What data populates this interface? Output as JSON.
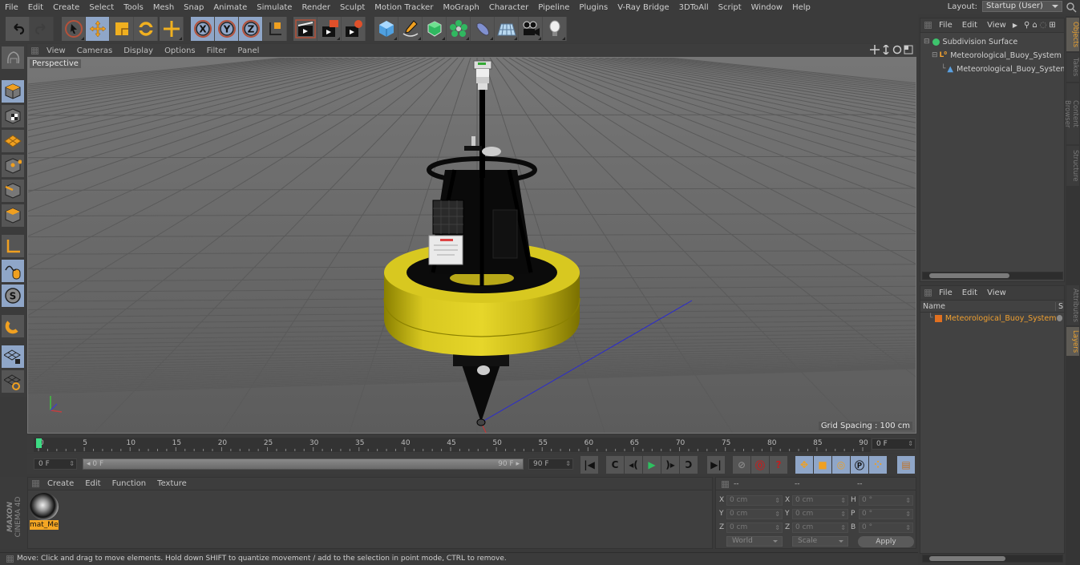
{
  "menubar": {
    "items": [
      "File",
      "Edit",
      "Create",
      "Select",
      "Tools",
      "Mesh",
      "Snap",
      "Animate",
      "Simulate",
      "Render",
      "Sculpt",
      "Motion Tracker",
      "MoGraph",
      "Character",
      "Pipeline",
      "Plugins",
      "V-Ray Bridge",
      "3DToAll",
      "Script",
      "Window",
      "Help"
    ],
    "layout_label": "Layout:",
    "layout_value": "Startup (User)"
  },
  "toolbar": {
    "groups": [
      [
        "undo-icon",
        "redo-icon"
      ],
      [
        "live-selection-icon",
        "move-icon",
        "scale-icon",
        "rotate-icon"
      ],
      [
        "create-object-icon"
      ],
      [
        "x-axis-lock-icon",
        "y-axis-lock-icon",
        "z-axis-lock-icon",
        "world-coordinates-icon"
      ],
      [
        "render-view-icon",
        "render-to-picture-viewer-icon",
        "render-settings-icon"
      ],
      [
        "cube-primitive-icon",
        "pen-spline-icon",
        "subdivision-surface-icon",
        "cloner-icon",
        "deformer-icon",
        "floor-icon",
        "camera-icon",
        "light-icon"
      ]
    ]
  },
  "left_tools": [
    "make-editable-icon",
    "model-mode-icon",
    "texture-mode-icon",
    "workplane-mode-icon",
    "points-mode-icon",
    "edges-mode-icon",
    "polygons-mode-icon",
    "axis-mode-icon",
    "tweak-mode-icon",
    "solo-mode-icon",
    "snap-icon",
    "locked-workplane-icon",
    "planar-workplane-icon"
  ],
  "viewport": {
    "menu": [
      "View",
      "Cameras",
      "Display",
      "Options",
      "Filter",
      "Panel"
    ],
    "camera_label": "Perspective",
    "grid_spacing": "Grid Spacing : 100 cm",
    "nav_icons": [
      "pan-icon",
      "dolly-icon",
      "orbit-icon",
      "maximize-view-icon"
    ]
  },
  "timeline": {
    "ticks": [
      "0",
      "5",
      "10",
      "15",
      "20",
      "25",
      "30",
      "35",
      "40",
      "45",
      "50",
      "55",
      "60",
      "65",
      "70",
      "75",
      "80",
      "85",
      "90"
    ],
    "current_frame": "0 F",
    "start_frame": "0 F",
    "range_start": "0 F",
    "range_end": "90 F",
    "end_frame": "90 F",
    "playhead_fraction": 0
  },
  "transport": {
    "buttons": [
      "go-to-start-icon",
      "previous-key-icon",
      "previous-frame-icon",
      "play-forward-icon",
      "next-frame-icon",
      "next-key-icon",
      "go-to-end-icon",
      "motion-record-icon",
      "record-active-objects-icon",
      "autokeying-icon",
      "key-position-icon",
      "key-scale-icon",
      "key-rotation-icon",
      "key-parameter-icon",
      "key-pla-icon",
      "timeline-window-icon"
    ]
  },
  "material_panel": {
    "menu": [
      "Create",
      "Edit",
      "Function",
      "Texture"
    ],
    "materials": [
      {
        "name": "mat_Me"
      }
    ]
  },
  "coordinates": {
    "headers": [
      "--",
      "--",
      "--"
    ],
    "position": [
      {
        "axis": "X",
        "value": "0 cm"
      },
      {
        "axis": "Y",
        "value": "0 cm"
      },
      {
        "axis": "Z",
        "value": "0 cm"
      }
    ],
    "size": [
      {
        "axis": "X",
        "value": "0 cm"
      },
      {
        "axis": "Y",
        "value": "0 cm"
      },
      {
        "axis": "Z",
        "value": "0 cm"
      }
    ],
    "rotation": [
      {
        "axis": "H",
        "value": "0 °"
      },
      {
        "axis": "P",
        "value": "0 °"
      },
      {
        "axis": "B",
        "value": "0 °"
      }
    ],
    "mode_select": "World",
    "size_select": "Scale",
    "apply_label": "Apply"
  },
  "status_bar": {
    "text": "Move: Click and drag to move elements. Hold down SHIFT to quantize movement / add to the selection in point mode, CTRL to remove."
  },
  "object_manager": {
    "menu": [
      "File",
      "Edit",
      "View"
    ],
    "objects": [
      {
        "name": "Subdivision Surface",
        "icon": "subdivision-surface-icon",
        "color": "#3ec46d"
      },
      {
        "name": "Meteorological_Buoy_System",
        "icon": "null-object-icon",
        "color": "#f0a030"
      },
      {
        "name": "Meteorological_Buoy_System_(",
        "icon": "polygon-object-icon",
        "color": "#5aa0e0"
      }
    ]
  },
  "layer_manager": {
    "menu": [
      "File",
      "Edit",
      "View"
    ],
    "column_name": "Name",
    "column_s": "S",
    "layers": [
      {
        "name": "Meteorological_Buoy_System",
        "color": "#e07020"
      }
    ]
  },
  "side_tabs": {
    "top": [
      {
        "label": "Objects",
        "active": true
      },
      {
        "label": "Takes",
        "active": false
      },
      {
        "label": "Content Browser",
        "active": false
      },
      {
        "label": "Structure",
        "active": false
      }
    ],
    "bottom": [
      {
        "label": "Attributes",
        "active": false
      },
      {
        "label": "Layers",
        "active": true
      }
    ]
  },
  "branding": {
    "line1": "MAXON",
    "line2": "CINEMA 4D"
  }
}
